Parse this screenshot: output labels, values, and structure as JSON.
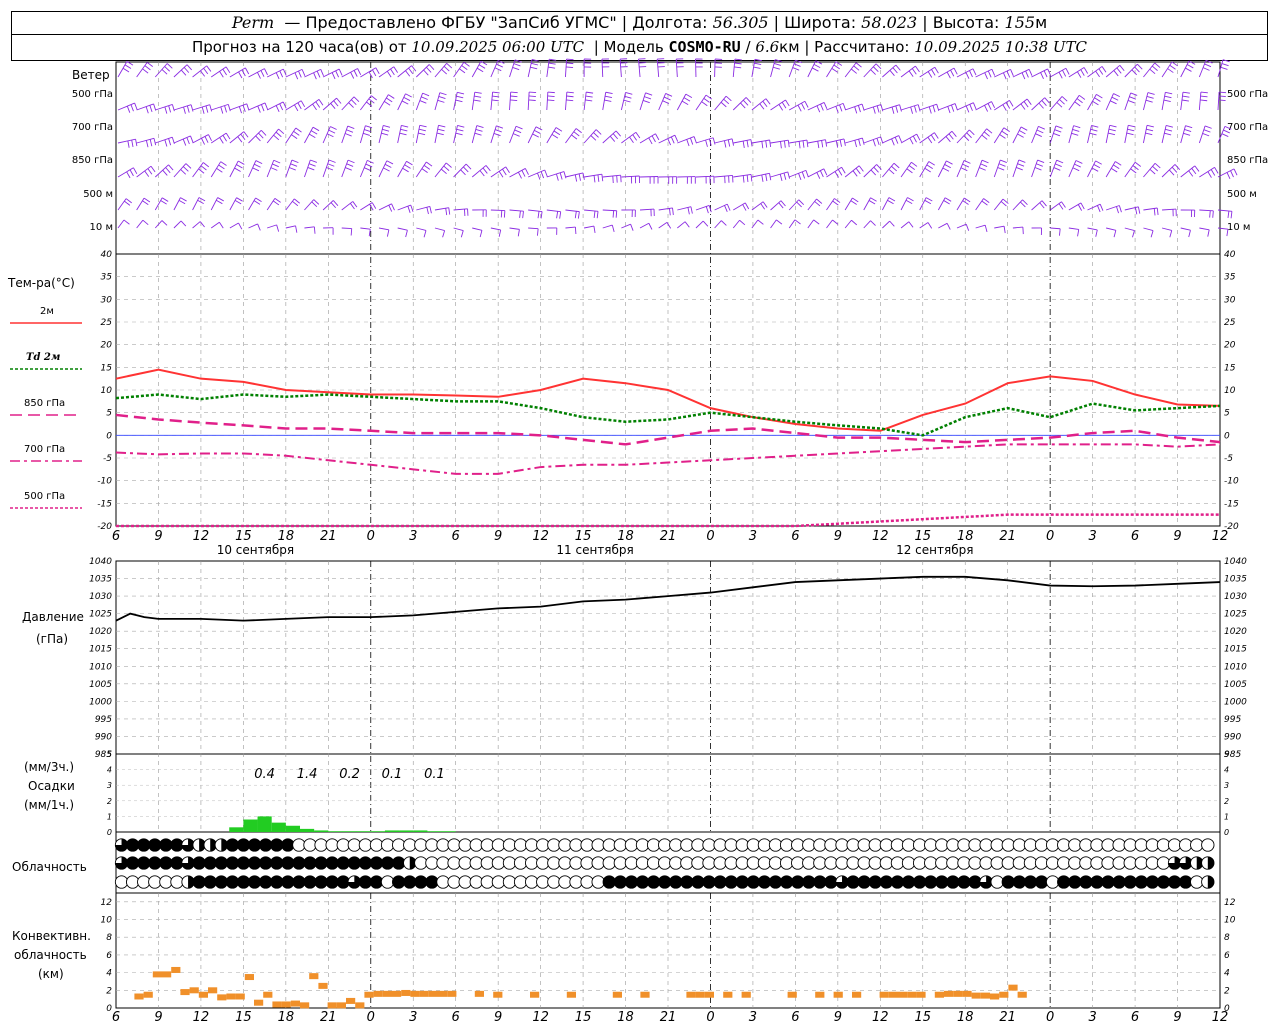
{
  "header": {
    "station": "Perm",
    "provider": "Предоставлено ФГБУ \"ЗапСиб УГМС\"",
    "lon_label": "Долгота:",
    "lon": "56.305",
    "lat_label": "Широта:",
    "lat": "58.023",
    "alt_label": "Высота:",
    "alt": "155",
    "alt_unit": "м",
    "forecast_label": "Прогноз на 120 часа(ов) от",
    "forecast_date": "10.09.2025 06:00 UTC",
    "model_label": "Модель",
    "model": "COSMO-RU",
    "model_res": "6.6",
    "model_res_unit": "км",
    "calc_label": "Рассчитано:",
    "calc_date": "10.09.2025 10:38 UTC"
  },
  "wind_panel": {
    "title": "Ветер",
    "levels": [
      "500 гПа",
      "700 гПа",
      "850 гПа",
      "500 м",
      "10 м"
    ]
  },
  "temp_panel": {
    "title": "Тем-ра(°С)",
    "legend": [
      {
        "label": "2м",
        "color": "#ff3333",
        "style": "solid"
      },
      {
        "label": "Td 2м",
        "color": "#008000",
        "style": "dotted"
      },
      {
        "label": "850 гПа",
        "color": "#e0208a",
        "style": "dashed"
      },
      {
        "label": "700 гПа",
        "color": "#e0208a",
        "style": "dashdot"
      },
      {
        "label": "500 гПа",
        "color": "#e0208a",
        "style": "dotted"
      }
    ]
  },
  "pressure_panel": {
    "title": "Давление",
    "unit": "(гПа)"
  },
  "precip_panel": {
    "label_top": "(мм/3ч.)",
    "label_mid": "Осадки",
    "label_bot": "(мм/1ч.)",
    "totals": [
      {
        "t": 9,
        "text": "0.4"
      },
      {
        "t": 12,
        "text": "1.4"
      },
      {
        "t": 15,
        "text": "0.2"
      },
      {
        "t": 18,
        "text": "0.1"
      },
      {
        "t": 21,
        "text": "0.1"
      }
    ]
  },
  "cloud_panel": {
    "title": "Облачность"
  },
  "conv_panel": {
    "title1": "Конвективн.",
    "title2": "облачность",
    "unit": "(км)"
  },
  "days": [
    {
      "t": 9,
      "label": "10 сентября"
    },
    {
      "t": 33,
      "label": "11 сентября"
    },
    {
      "t": 57,
      "label": "12 сентября"
    }
  ],
  "x_hours": [
    "6",
    "9",
    "12",
    "15",
    "18",
    "21",
    "0",
    "3",
    "6",
    "9",
    "12",
    "15",
    "18",
    "21",
    "0",
    "3",
    "6",
    "9",
    "12",
    "15",
    "18",
    "21",
    "0",
    "3",
    "6",
    "9",
    "12"
  ],
  "chart_data": [
    {
      "type": "line",
      "title": "Тем-ра(°С)",
      "x_unit": "hours from 10.09.2025 06:00 UTC",
      "ylim": [
        -20,
        40
      ],
      "yticks": [
        -20,
        -15,
        -10,
        -5,
        0,
        5,
        10,
        15,
        20,
        25,
        30,
        35,
        40
      ],
      "series": [
        {
          "name": "2м",
          "color": "#ff3333",
          "x": [
            0,
            3,
            6,
            9,
            12,
            15,
            18,
            21,
            24,
            27,
            30,
            33,
            36,
            39,
            42,
            45,
            48,
            51,
            54,
            57,
            60,
            63,
            66,
            69,
            72,
            75,
            78
          ],
          "values": [
            12.5,
            14.5,
            12.5,
            11.8,
            10,
            9.5,
            9,
            9,
            8.8,
            8.5,
            10,
            12.5,
            11.5,
            10,
            6,
            4,
            2.5,
            1.5,
            1,
            4.5,
            7,
            11.5,
            13,
            12,
            9,
            6.8,
            6.5
          ]
        },
        {
          "name": "Td 2м",
          "color": "#008000",
          "x": [
            0,
            3,
            6,
            9,
            12,
            15,
            18,
            21,
            24,
            27,
            30,
            33,
            36,
            39,
            42,
            45,
            48,
            51,
            54,
            57,
            60,
            63,
            66,
            69,
            72,
            75,
            78
          ],
          "values": [
            8.2,
            9,
            8,
            9,
            8.5,
            9,
            8.5,
            8,
            7.5,
            7.5,
            6,
            4,
            3,
            3.5,
            5,
            4,
            3,
            2.2,
            1.5,
            0,
            4,
            6,
            4,
            7,
            5.5,
            6,
            6.5
          ]
        },
        {
          "name": "850 гПа",
          "color": "#e0208a",
          "x": [
            0,
            3,
            6,
            9,
            12,
            15,
            18,
            21,
            24,
            27,
            30,
            33,
            36,
            39,
            42,
            45,
            48,
            51,
            54,
            57,
            60,
            63,
            66,
            69,
            72,
            75,
            78
          ],
          "values": [
            4.5,
            3.5,
            2.8,
            2.2,
            1.5,
            1.5,
            1,
            0.5,
            0.5,
            0.5,
            0,
            -1,
            -2,
            -0.5,
            1,
            1.5,
            0.5,
            -0.5,
            -0.5,
            -1,
            -1.5,
            -1,
            -0.5,
            0.5,
            1,
            -0.5,
            -1.5
          ]
        },
        {
          "name": "700 гПа",
          "color": "#e0208a",
          "x": [
            0,
            3,
            6,
            9,
            12,
            15,
            18,
            21,
            24,
            27,
            30,
            33,
            36,
            39,
            42,
            45,
            48,
            51,
            54,
            57,
            60,
            63,
            66,
            69,
            72,
            75,
            78
          ],
          "values": [
            -3.8,
            -4.2,
            -4,
            -4,
            -4.5,
            -5.5,
            -6.5,
            -7.5,
            -8.5,
            -8.5,
            -7,
            -6.5,
            -6.5,
            -6,
            -5.5,
            -5,
            -4.5,
            -4,
            -3.5,
            -3,
            -2.5,
            -2,
            -2,
            -2,
            -2,
            -2.5,
            -2
          ]
        },
        {
          "name": "500 гПа",
          "color": "#e0208a",
          "x": [
            0,
            3,
            6,
            9,
            12,
            15,
            18,
            21,
            24,
            27,
            30,
            33,
            36,
            39,
            42,
            45,
            48,
            51,
            54,
            57,
            60,
            63,
            66,
            69,
            72,
            75,
            78
          ],
          "values": [
            -20,
            -20,
            -20,
            -20,
            -20,
            -20,
            -20,
            -20,
            -20,
            -20,
            -20,
            -20,
            -20,
            -20,
            -20,
            -20,
            -20,
            -19.5,
            -19,
            -18.5,
            -18,
            -17.5,
            -17.5,
            -17.5,
            -17.5,
            -17.5,
            -17.5
          ]
        }
      ]
    },
    {
      "type": "line",
      "title": "Давление",
      "ylim": [
        985,
        1040
      ],
      "yticks": [
        985,
        990,
        995,
        1000,
        1005,
        1010,
        1015,
        1020,
        1025,
        1030,
        1035,
        1040
      ],
      "series": [
        {
          "name": "Давление",
          "color": "#000000",
          "x": [
            0,
            1,
            2,
            3,
            4,
            6,
            9,
            12,
            15,
            18,
            21,
            24,
            27,
            30,
            33,
            36,
            39,
            42,
            45,
            48,
            51,
            54,
            57,
            60,
            63,
            66,
            69,
            72,
            75,
            78
          ],
          "values": [
            1023,
            1025,
            1024,
            1023.5,
            1023.5,
            1023.5,
            1023,
            1023.5,
            1024,
            1024,
            1024.5,
            1025.5,
            1026.5,
            1027,
            1028.5,
            1029,
            1030,
            1031,
            1032.5,
            1034,
            1034.5,
            1035,
            1035.5,
            1035.5,
            1034.5,
            1033,
            1032.8,
            1033,
            1033.5,
            1034
          ]
        }
      ]
    },
    {
      "type": "bar",
      "title": "Осадки",
      "ylim": [
        0,
        5
      ],
      "yticks": [
        0,
        1,
        2,
        3,
        4,
        5
      ],
      "series": [
        {
          "name": "Осадки",
          "color": "#22cc22",
          "x": [
            8,
            9,
            10,
            11,
            12,
            13,
            14,
            15,
            16,
            17,
            18,
            19,
            20,
            21,
            22,
            23
          ],
          "values": [
            0.3,
            0.8,
            1.0,
            0.6,
            0.4,
            0.2,
            0.1,
            0.05,
            0.05,
            0.05,
            0.05,
            0.1,
            0.1,
            0.1,
            0.05,
            0.05
          ]
        }
      ]
    },
    {
      "type": "bar",
      "title": "Конвективн. облачность",
      "ylim": [
        0,
        13
      ],
      "yticks": [
        0,
        2,
        4,
        6,
        8,
        10,
        12
      ],
      "series": [
        {
          "name": "Конвективн. облачность",
          "color": "#f0902a",
          "x": [
            2,
            3,
            4,
            5,
            6,
            7,
            8,
            9,
            10,
            11,
            12,
            13,
            14,
            15,
            16,
            17,
            18,
            19,
            20,
            21,
            22,
            23,
            24,
            25,
            26,
            27,
            28,
            29,
            30,
            31,
            32,
            33,
            34,
            35,
            36,
            39,
            41,
            45,
            49,
            54,
            57,
            62,
            63,
            64,
            66,
            68,
            73,
            76,
            78,
            80,
            83,
            84,
            85,
            86,
            87,
            89,
            90,
            91,
            92,
            93,
            94,
            95,
            96,
            97,
            98
          ],
          "values": [
            1.3,
            1.5,
            3.8,
            3.8,
            4.3,
            1.8,
            2,
            1.5,
            2,
            1.2,
            1.3,
            1.3,
            3.5,
            0.6,
            1.5,
            0.4,
            0.4,
            0.5,
            0.3,
            3.6,
            2.5,
            0.3,
            0.3,
            0.8,
            0.3,
            1.5,
            1.6,
            1.6,
            1.6,
            1.7,
            1.6,
            1.6,
            1.6,
            1.6,
            1.6,
            1.6,
            1.5,
            1.5,
            1.5,
            1.5,
            1.5,
            1.5,
            1.5,
            1.5,
            1.5,
            1.5,
            1.5,
            1.5,
            1.5,
            1.5,
            1.5,
            1.5,
            1.5,
            1.5,
            1.5,
            1.5,
            1.6,
            1.6,
            1.6,
            1.4,
            1.4,
            1.3,
            1.5,
            2.3,
            1.5
          ]
        }
      ]
    }
  ]
}
